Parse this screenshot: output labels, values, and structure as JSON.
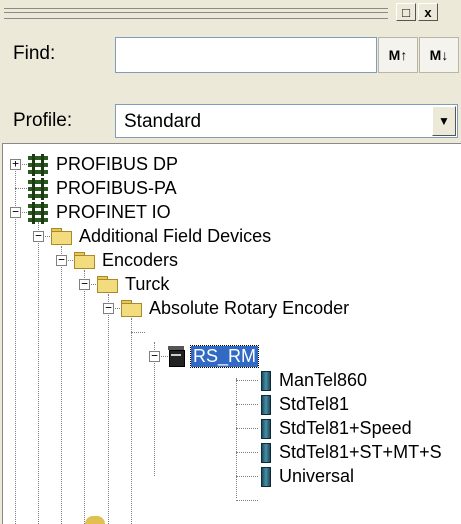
{
  "window": {
    "restore_glyph": "□",
    "close_glyph": "x"
  },
  "find": {
    "label": "Find:",
    "input_value": "",
    "find_up_glyph": "M↑",
    "find_down_glyph": "M↓"
  },
  "profile": {
    "label": "Profile:",
    "selected": "Standard",
    "dropdown_glyph": "▼"
  },
  "tree": {
    "nodes": [
      {
        "label": "PROFIBUS DP",
        "expander": "+",
        "icon": "network-icon"
      },
      {
        "label": "PROFIBUS-PA",
        "expander": "",
        "icon": "network-icon"
      },
      {
        "label": "PROFINET IO",
        "expander": "−",
        "icon": "network-icon"
      },
      {
        "label": "Additional Field Devices",
        "expander": "−",
        "icon": "folder-icon"
      },
      {
        "label": "Encoders",
        "expander": "−",
        "icon": "folder-icon"
      },
      {
        "label": "Turck",
        "expander": "−",
        "icon": "folder-icon"
      },
      {
        "label": "Absolute Rotary Encoder",
        "expander": "−",
        "icon": "folder-icon"
      },
      {
        "label": "RS_RM",
        "expander": "−",
        "icon": "station-icon",
        "selected": true
      },
      {
        "label": "ManTel860",
        "expander": "",
        "icon": "module-icon"
      },
      {
        "label": "StdTel81",
        "expander": "",
        "icon": "module-icon"
      },
      {
        "label": "StdTel81+Speed",
        "expander": "",
        "icon": "module-icon"
      },
      {
        "label": "StdTel81+ST+MT+S",
        "expander": "",
        "icon": "module-icon"
      },
      {
        "label": "Universal",
        "expander": "",
        "icon": "module-icon"
      }
    ]
  }
}
